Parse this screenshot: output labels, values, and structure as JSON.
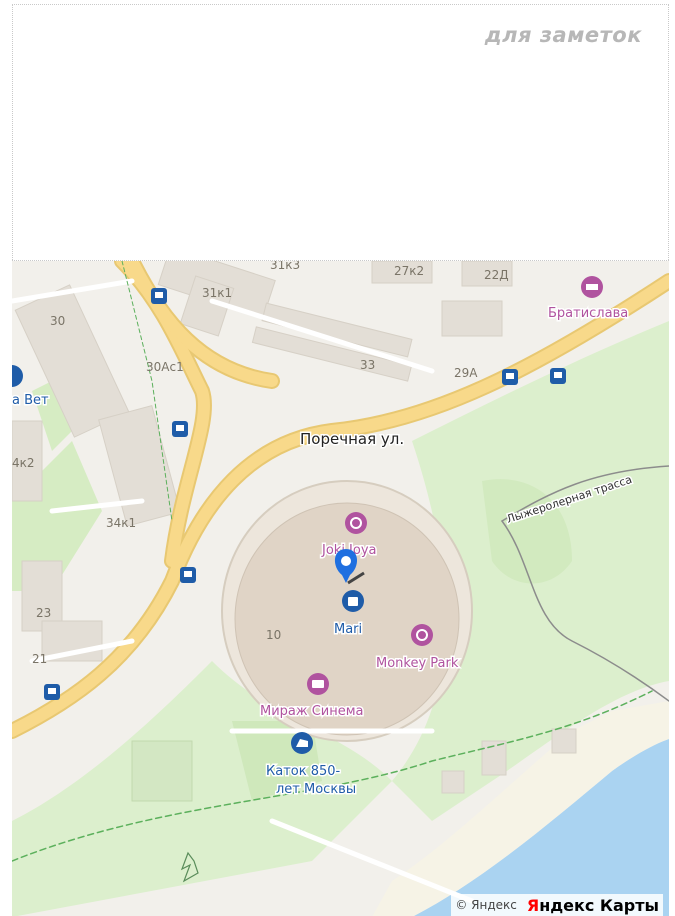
{
  "notes": {
    "title": "для заметок"
  },
  "map": {
    "streets": {
      "porechnaya": "Поречная ул.",
      "trail": "Лыжеролерная трасса"
    },
    "buildings": [
      "31к3",
      "27к2",
      "22Д",
      "31к1",
      "30",
      "30Ас1",
      "33",
      "29А",
      "4к2",
      "34к1",
      "23",
      "21",
      "10"
    ],
    "pois": {
      "bratislava": "Братислава",
      "vet": "а Вет",
      "joy": "Joki Joya",
      "mari": "Mari",
      "monkey": "Monkey Park",
      "mirage": "Мираж Синема",
      "katok_1": "Каток 850-",
      "katok_2": "лет Москвы"
    },
    "colors": {
      "road": "#f8d98a",
      "green": "#d4ecc0",
      "water": "#aad3f1",
      "poi": "#b0539f",
      "transit": "#1f5ca8"
    }
  },
  "footer": {
    "copyright": "© Яндекс",
    "brand_a": "Я",
    "brand_b": "ндекс Карты"
  }
}
